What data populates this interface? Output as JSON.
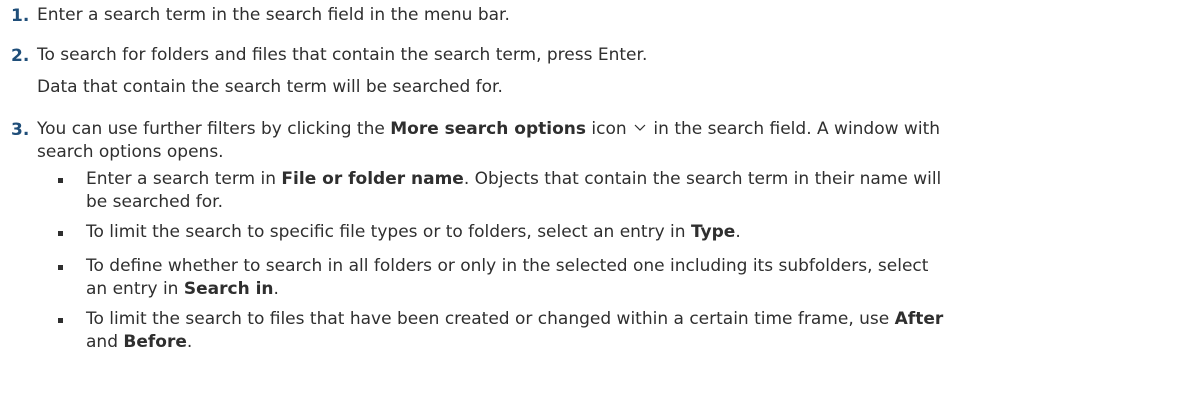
{
  "steps": [
    {
      "number": "1.",
      "text": "Enter a search term in the search field in the menu bar."
    },
    {
      "number": "2.",
      "text": "To search for folders and files that contain the search term, press Enter.",
      "result": "Data that contain the search term will be searched for."
    },
    {
      "number": "3.",
      "text_before": "You can use further filters by clicking the ",
      "bold": "More search options",
      "text_mid": " icon ",
      "icon": "chevron-down-icon",
      "text_after": " in the search field. A window with",
      "text_line2": "search options opens.",
      "bullets": [
        {
          "pre": "Enter a search term in ",
          "bold": "File or folder name",
          "post_line1": ". Objects that contain the search term in their name will",
          "line2": "be searched for."
        },
        {
          "pre": "To limit the search to specific file types or to folders, select an entry in ",
          "bold": "Type",
          "post": "."
        },
        {
          "line1": "To define whether to search in all folders or only in the selected one including its subfolders, select",
          "pre2": "an entry in ",
          "bold": "Search in",
          "post2": "."
        },
        {
          "pre": "To limit the search to files that have been created or changed within a certain time frame, use ",
          "bold1": "After",
          "pre2": "and ",
          "bold2": "Before",
          "post2": "."
        }
      ]
    }
  ]
}
